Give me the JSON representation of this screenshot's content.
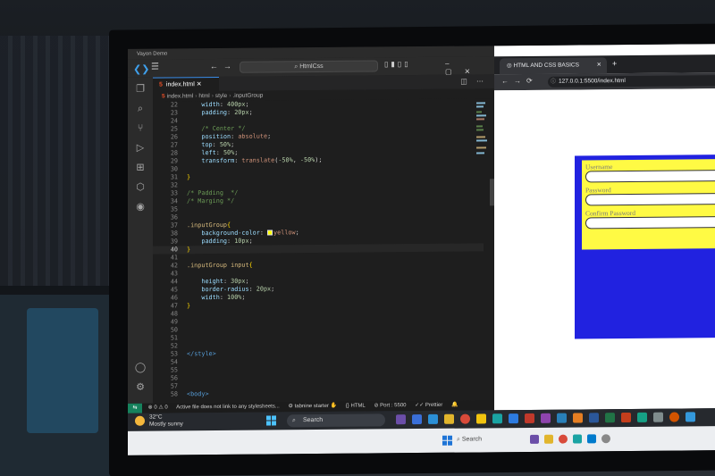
{
  "vscode": {
    "window_title": "Vayon Demo",
    "search": "HtmlCss",
    "tab": {
      "filename": "index.html"
    },
    "breadcrumb": [
      "index.html",
      "html",
      "style",
      ".inputGroup"
    ],
    "code_lines": [
      {
        "n": "22",
        "segs": [
          [
            "    ",
            "t"
          ],
          [
            "width",
            "p"
          ],
          [
            ": ",
            "t"
          ],
          [
            "400px",
            "n"
          ],
          [
            ";",
            "t"
          ]
        ]
      },
      {
        "n": "23",
        "segs": [
          [
            "    ",
            "t"
          ],
          [
            "padding",
            "p"
          ],
          [
            ": ",
            "t"
          ],
          [
            "20px",
            "n"
          ],
          [
            ";",
            "t"
          ]
        ]
      },
      {
        "n": "24",
        "segs": []
      },
      {
        "n": "25",
        "segs": [
          [
            "    ",
            "t"
          ],
          [
            "/* Center */",
            "c"
          ]
        ]
      },
      {
        "n": "26",
        "segs": [
          [
            "    ",
            "t"
          ],
          [
            "position",
            "p"
          ],
          [
            ": ",
            "t"
          ],
          [
            "absolute",
            "v"
          ],
          [
            ";",
            "t"
          ]
        ]
      },
      {
        "n": "27",
        "segs": [
          [
            "    ",
            "t"
          ],
          [
            "top",
            "p"
          ],
          [
            ": ",
            "t"
          ],
          [
            "50%",
            "n"
          ],
          [
            ";",
            "t"
          ]
        ]
      },
      {
        "n": "28",
        "segs": [
          [
            "    ",
            "t"
          ],
          [
            "left",
            "p"
          ],
          [
            ": ",
            "t"
          ],
          [
            "50%",
            "n"
          ],
          [
            ";",
            "t"
          ]
        ]
      },
      {
        "n": "29",
        "segs": [
          [
            "    ",
            "t"
          ],
          [
            "transform",
            "p"
          ],
          [
            ": ",
            "t"
          ],
          [
            "translate",
            "v"
          ],
          [
            "(",
            "t"
          ],
          [
            "-50%",
            "n"
          ],
          [
            ", ",
            "t"
          ],
          [
            "-50%",
            "n"
          ],
          [
            ");",
            "t"
          ]
        ]
      },
      {
        "n": "30",
        "segs": []
      },
      {
        "n": "31",
        "segs": [
          [
            "}",
            "b"
          ]
        ]
      },
      {
        "n": "32",
        "segs": []
      },
      {
        "n": "33",
        "segs": [
          [
            "/* Padding  */",
            "c"
          ]
        ]
      },
      {
        "n": "34",
        "segs": [
          [
            "/* Marging */",
            "c"
          ]
        ]
      },
      {
        "n": "35",
        "segs": []
      },
      {
        "n": "36",
        "segs": []
      },
      {
        "n": "37",
        "segs": [
          [
            ".inputGroup",
            "s"
          ],
          [
            "{",
            "b"
          ]
        ]
      },
      {
        "n": "38",
        "segs": [
          [
            "    ",
            "t"
          ],
          [
            "background-color",
            "p"
          ],
          [
            ": ",
            "t"
          ],
          [
            "yellow",
            "v"
          ],
          [
            ";",
            "t"
          ]
        ],
        "swatch": true
      },
      {
        "n": "39",
        "segs": [
          [
            "    ",
            "t"
          ],
          [
            "padding",
            "p"
          ],
          [
            ": ",
            "t"
          ],
          [
            "10px",
            "n"
          ],
          [
            ";",
            "t"
          ]
        ]
      },
      {
        "n": "40",
        "segs": [
          [
            "}",
            "b"
          ]
        ],
        "current": true
      },
      {
        "n": "41",
        "segs": []
      },
      {
        "n": "42",
        "segs": [
          [
            ".inputGroup ",
            "s"
          ],
          [
            "input",
            "s"
          ],
          [
            "{",
            "b"
          ]
        ]
      },
      {
        "n": "43",
        "segs": []
      },
      {
        "n": "44",
        "segs": [
          [
            "    ",
            "t"
          ],
          [
            "height",
            "p"
          ],
          [
            ": ",
            "t"
          ],
          [
            "30px",
            "n"
          ],
          [
            ";",
            "t"
          ]
        ]
      },
      {
        "n": "45",
        "segs": [
          [
            "    ",
            "t"
          ],
          [
            "border-radius",
            "p"
          ],
          [
            ": ",
            "t"
          ],
          [
            "20px",
            "n"
          ],
          [
            ";",
            "t"
          ]
        ]
      },
      {
        "n": "46",
        "segs": [
          [
            "    ",
            "t"
          ],
          [
            "width",
            "p"
          ],
          [
            ": ",
            "t"
          ],
          [
            "100%",
            "n"
          ],
          [
            ";",
            "t"
          ]
        ]
      },
      {
        "n": "47",
        "segs": [
          [
            "}",
            "b"
          ]
        ]
      },
      {
        "n": "48",
        "segs": []
      },
      {
        "n": "49",
        "segs": []
      },
      {
        "n": "50",
        "segs": []
      },
      {
        "n": "51",
        "segs": []
      },
      {
        "n": "52",
        "segs": []
      },
      {
        "n": "53",
        "segs": [
          [
            "</",
            "k"
          ],
          [
            "style",
            "k"
          ],
          [
            ">",
            "k"
          ]
        ]
      },
      {
        "n": "54",
        "segs": []
      },
      {
        "n": "55",
        "segs": []
      },
      {
        "n": "56",
        "segs": []
      },
      {
        "n": "57",
        "segs": []
      },
      {
        "n": "58",
        "segs": [
          [
            "<",
            "k"
          ],
          [
            "body",
            "k"
          ],
          [
            ">",
            "k"
          ]
        ]
      }
    ],
    "status": {
      "problems": "⊗ 0 ⚠ 0",
      "message": "Active file does not link to any stylesheets...",
      "tabnine": "tabnine starter",
      "language": "HTML",
      "port": "Port : 5500",
      "prettier": "Prettier"
    }
  },
  "browser": {
    "tab_title": "HTML AND CSS BASICS",
    "url": "127.0.0.1:5500/index.html",
    "labels": [
      "Username",
      "Password",
      "Confirm Password"
    ]
  },
  "taskbar": {
    "temperature": "32°C",
    "weather": "Mostly sunny",
    "search_label": "Search",
    "search_label_2": "Search"
  },
  "colors": {
    "page_blue": "#2122e0",
    "input_group_yellow": "#fffa44",
    "vscode_accent": "#3b8eea"
  }
}
